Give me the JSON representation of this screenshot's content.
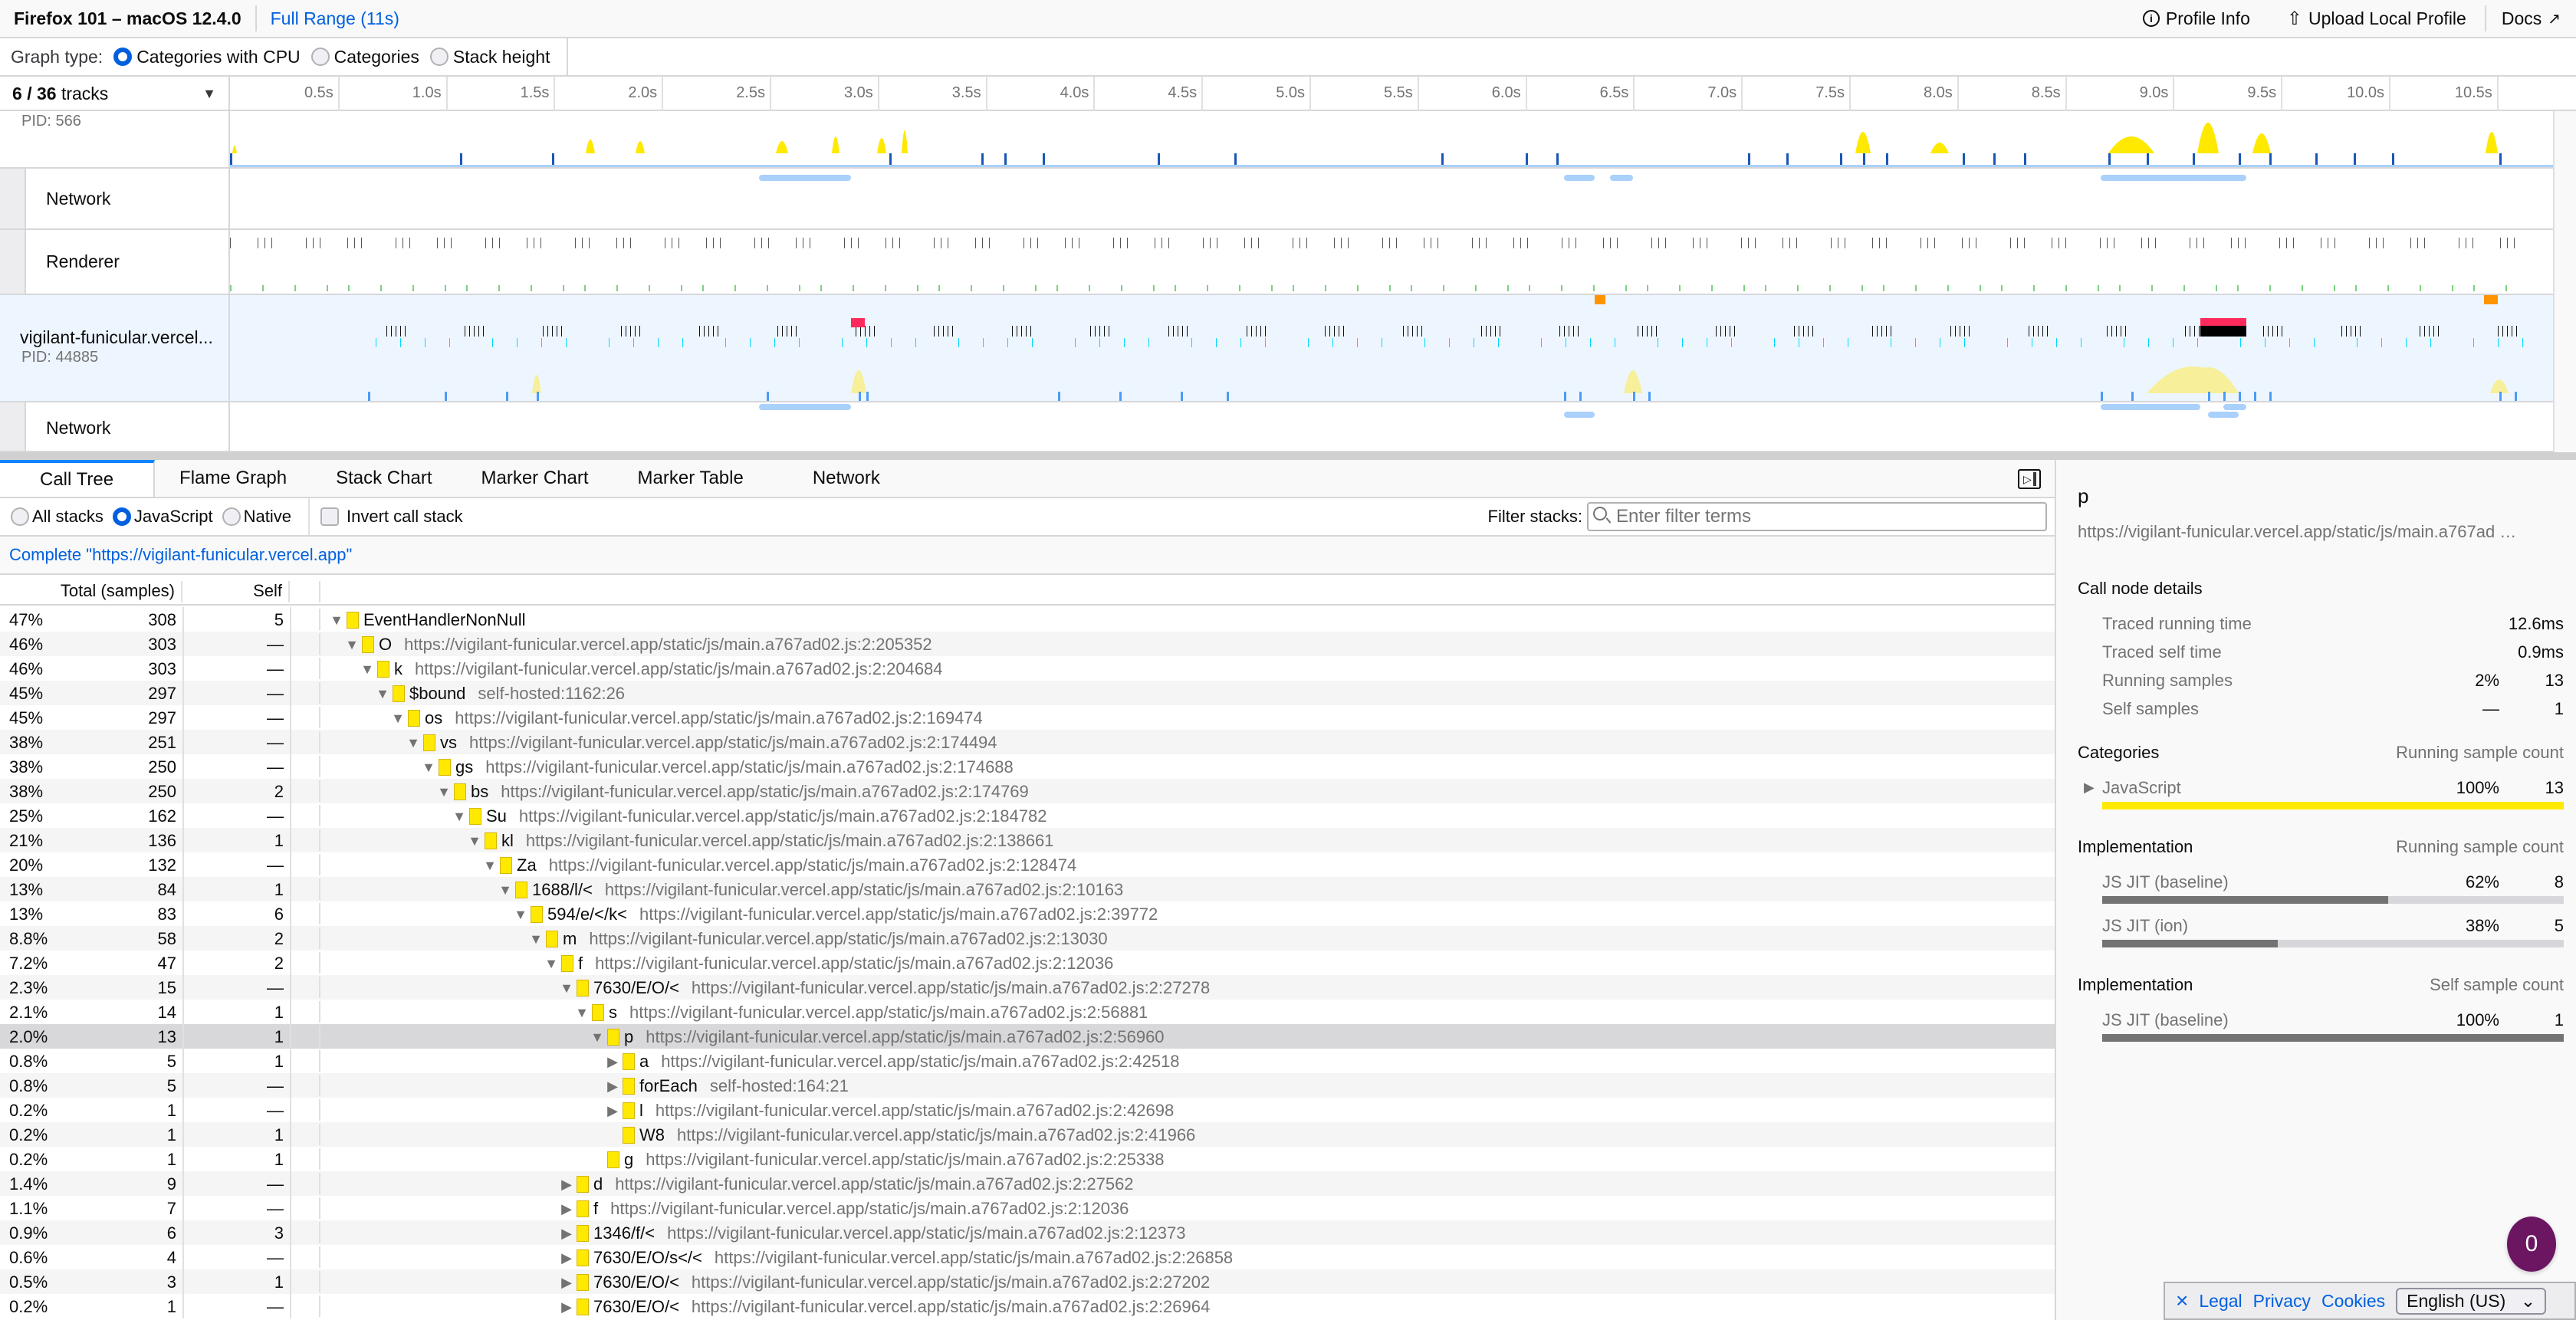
{
  "topbar": {
    "title": "Firefox 101 – macOS 12.4.0",
    "range": "Full Range (11s)",
    "profile_info": "Profile Info",
    "upload": "Upload Local Profile",
    "docs": "Docs"
  },
  "graph_type": {
    "label": "Graph type:",
    "options": [
      "Categories with CPU",
      "Categories",
      "Stack height"
    ],
    "selected": "Categories with CPU"
  },
  "ruler": {
    "tracks_visible": "6",
    "tracks_total": "36",
    "tracks_suffix": "tracks",
    "ticks": [
      "0.5s",
      "1.0s",
      "1.5s",
      "2.0s",
      "2.5s",
      "3.0s",
      "3.5s",
      "4.0s",
      "4.5s",
      "5.0s",
      "5.5s",
      "6.0s",
      "6.5s",
      "7.0s",
      "7.5s",
      "8.0s",
      "8.5s",
      "9.0s",
      "9.5s",
      "10.0s",
      "10.5s"
    ]
  },
  "tracks": [
    {
      "name": "",
      "pid": "PID: 566"
    },
    {
      "name": "Network"
    },
    {
      "name": "Renderer"
    },
    {
      "name": "vigilant-funicular.vercel...",
      "pid": "PID: 44885",
      "selected": true
    },
    {
      "name": "Network"
    }
  ],
  "tabs": [
    "Call Tree",
    "Flame Graph",
    "Stack Chart",
    "Marker Chart",
    "Marker Table",
    "Network"
  ],
  "active_tab": "Call Tree",
  "settings": {
    "stack_options": [
      "All stacks",
      "JavaScript",
      "Native"
    ],
    "selected_stack": "JavaScript",
    "invert_label": "Invert call stack",
    "invert_checked": false,
    "filter_label": "Filter stacks:",
    "filter_placeholder": "Enter filter terms",
    "filter_value": ""
  },
  "breadcrumb": "Complete \"https://vigilant-funicular.vercel.app\"",
  "tree": {
    "header_total": "Total (samples)",
    "header_self": "Self",
    "rows": [
      {
        "pct": "47%",
        "total": "308",
        "self": "5",
        "depth": 0,
        "open": "down",
        "name": "EventHandlerNonNull",
        "loc": ""
      },
      {
        "pct": "46%",
        "total": "303",
        "self": "—",
        "depth": 1,
        "open": "down",
        "name": "O",
        "loc": "https://vigilant-funicular.vercel.app/static/js/main.a767ad02.js:2:205352"
      },
      {
        "pct": "46%",
        "total": "303",
        "self": "—",
        "depth": 2,
        "open": "down",
        "name": "k",
        "loc": "https://vigilant-funicular.vercel.app/static/js/main.a767ad02.js:2:204684"
      },
      {
        "pct": "45%",
        "total": "297",
        "self": "—",
        "depth": 3,
        "open": "down",
        "name": "$bound",
        "loc": "self-hosted:1162:26"
      },
      {
        "pct": "45%",
        "total": "297",
        "self": "—",
        "depth": 4,
        "open": "down",
        "name": "os",
        "loc": "https://vigilant-funicular.vercel.app/static/js/main.a767ad02.js:2:169474"
      },
      {
        "pct": "38%",
        "total": "251",
        "self": "—",
        "depth": 5,
        "open": "down",
        "name": "vs",
        "loc": "https://vigilant-funicular.vercel.app/static/js/main.a767ad02.js:2:174494"
      },
      {
        "pct": "38%",
        "total": "250",
        "self": "—",
        "depth": 6,
        "open": "down",
        "name": "gs",
        "loc": "https://vigilant-funicular.vercel.app/static/js/main.a767ad02.js:2:174688"
      },
      {
        "pct": "38%",
        "total": "250",
        "self": "2",
        "depth": 7,
        "open": "down",
        "name": "bs",
        "loc": "https://vigilant-funicular.vercel.app/static/js/main.a767ad02.js:2:174769"
      },
      {
        "pct": "25%",
        "total": "162",
        "self": "—",
        "depth": 8,
        "open": "down",
        "name": "Su",
        "loc": "https://vigilant-funicular.vercel.app/static/js/main.a767ad02.js:2:184782"
      },
      {
        "pct": "21%",
        "total": "136",
        "self": "1",
        "depth": 9,
        "open": "down",
        "name": "kl",
        "loc": "https://vigilant-funicular.vercel.app/static/js/main.a767ad02.js:2:138661"
      },
      {
        "pct": "20%",
        "total": "132",
        "self": "—",
        "depth": 10,
        "open": "down",
        "name": "Za",
        "loc": "https://vigilant-funicular.vercel.app/static/js/main.a767ad02.js:2:128474"
      },
      {
        "pct": "13%",
        "total": "84",
        "self": "1",
        "depth": 11,
        "open": "down",
        "name": "1688/l/<",
        "loc": "https://vigilant-funicular.vercel.app/static/js/main.a767ad02.js:2:10163"
      },
      {
        "pct": "13%",
        "total": "83",
        "self": "6",
        "depth": 12,
        "open": "down",
        "name": "594/e/</k<",
        "loc": "https://vigilant-funicular.vercel.app/static/js/main.a767ad02.js:2:39772"
      },
      {
        "pct": "8.8%",
        "total": "58",
        "self": "2",
        "depth": 13,
        "open": "down",
        "name": "m",
        "loc": "https://vigilant-funicular.vercel.app/static/js/main.a767ad02.js:2:13030"
      },
      {
        "pct": "7.2%",
        "total": "47",
        "self": "2",
        "depth": 14,
        "open": "down",
        "name": "f",
        "loc": "https://vigilant-funicular.vercel.app/static/js/main.a767ad02.js:2:12036"
      },
      {
        "pct": "2.3%",
        "total": "15",
        "self": "—",
        "depth": 15,
        "open": "down",
        "name": "7630/E/O/<",
        "loc": "https://vigilant-funicular.vercel.app/static/js/main.a767ad02.js:2:27278"
      },
      {
        "pct": "2.1%",
        "total": "14",
        "self": "1",
        "depth": 16,
        "open": "down",
        "name": "s",
        "loc": "https://vigilant-funicular.vercel.app/static/js/main.a767ad02.js:2:56881"
      },
      {
        "pct": "2.0%",
        "total": "13",
        "self": "1",
        "depth": 17,
        "open": "down",
        "name": "p",
        "loc": "https://vigilant-funicular.vercel.app/static/js/main.a767ad02.js:2:56960",
        "selected": true
      },
      {
        "pct": "0.8%",
        "total": "5",
        "self": "1",
        "depth": 18,
        "open": "right",
        "name": "a",
        "loc": "https://vigilant-funicular.vercel.app/static/js/main.a767ad02.js:2:42518"
      },
      {
        "pct": "0.8%",
        "total": "5",
        "self": "—",
        "depth": 18,
        "open": "right",
        "name": "forEach",
        "loc": "self-hosted:164:21"
      },
      {
        "pct": "0.2%",
        "total": "1",
        "self": "—",
        "depth": 18,
        "open": "right",
        "name": "l",
        "loc": "https://vigilant-funicular.vercel.app/static/js/main.a767ad02.js:2:42698"
      },
      {
        "pct": "0.2%",
        "total": "1",
        "self": "1",
        "depth": 18,
        "open": "none",
        "name": "W8",
        "loc": "https://vigilant-funicular.vercel.app/static/js/main.a767ad02.js:2:41966"
      },
      {
        "pct": "0.2%",
        "total": "1",
        "self": "1",
        "depth": 17,
        "open": "none",
        "name": "g",
        "loc": "https://vigilant-funicular.vercel.app/static/js/main.a767ad02.js:2:25338"
      },
      {
        "pct": "1.4%",
        "total": "9",
        "self": "—",
        "depth": 15,
        "open": "right",
        "name": "d",
        "loc": "https://vigilant-funicular.vercel.app/static/js/main.a767ad02.js:2:27562"
      },
      {
        "pct": "1.1%",
        "total": "7",
        "self": "—",
        "depth": 15,
        "open": "right",
        "name": "f",
        "loc": "https://vigilant-funicular.vercel.app/static/js/main.a767ad02.js:2:12036"
      },
      {
        "pct": "0.9%",
        "total": "6",
        "self": "3",
        "depth": 15,
        "open": "right",
        "name": "1346/f/<",
        "loc": "https://vigilant-funicular.vercel.app/static/js/main.a767ad02.js:2:12373"
      },
      {
        "pct": "0.6%",
        "total": "4",
        "self": "—",
        "depth": 15,
        "open": "right",
        "name": "7630/E/O/s</<",
        "loc": "https://vigilant-funicular.vercel.app/static/js/main.a767ad02.js:2:26858"
      },
      {
        "pct": "0.5%",
        "total": "3",
        "self": "1",
        "depth": 15,
        "open": "right",
        "name": "7630/E/O/<",
        "loc": "https://vigilant-funicular.vercel.app/static/js/main.a767ad02.js:2:27202"
      },
      {
        "pct": "0.2%",
        "total": "1",
        "self": "—",
        "depth": 15,
        "open": "right",
        "name": "7630/E/O/<",
        "loc": "https://vigilant-funicular.vercel.app/static/js/main.a767ad02.js:2:26964"
      }
    ]
  },
  "sidebar": {
    "title": "p",
    "url": "https://vigilant-funicular.vercel.app/static/js/main.a767ad …",
    "details_heading": "Call node details",
    "details": [
      {
        "label": "Traced running time",
        "pct": "",
        "value": "12.6ms"
      },
      {
        "label": "Traced self time",
        "pct": "",
        "value": "0.9ms"
      },
      {
        "label": "Running samples",
        "pct": "2%",
        "value": "13"
      },
      {
        "label": "Self samples",
        "pct": "—",
        "value": "1"
      }
    ],
    "categories_heading": "Categories",
    "categories_right": "Running sample count",
    "categories": [
      {
        "label": "JavaScript",
        "pct": "100%",
        "value": "13",
        "fraction": 1.0,
        "color": "#ffe900"
      }
    ],
    "impl_running_heading": "Implementation",
    "impl_running_right": "Running sample count",
    "impl_running": [
      {
        "label": "JS JIT (baseline)",
        "pct": "62%",
        "value": "8",
        "fraction": 0.62
      },
      {
        "label": "JS JIT (ion)",
        "pct": "38%",
        "value": "5",
        "fraction": 0.38
      }
    ],
    "impl_self_heading": "Implementation",
    "impl_self_right": "Self sample count",
    "impl_self": [
      {
        "label": "JS JIT (baseline)",
        "pct": "100%",
        "value": "1",
        "fraction": 1.0
      }
    ]
  },
  "footer": {
    "close": "×",
    "links": [
      "Legal",
      "Privacy",
      "Cookies"
    ],
    "language": "English (US)"
  },
  "badge": "0",
  "colors": {
    "accent": "#0060df",
    "tab_active": "#0a84ff",
    "js_category": "#ffe900",
    "badge": "#6c1561",
    "selected_track": "#edf6ff"
  }
}
